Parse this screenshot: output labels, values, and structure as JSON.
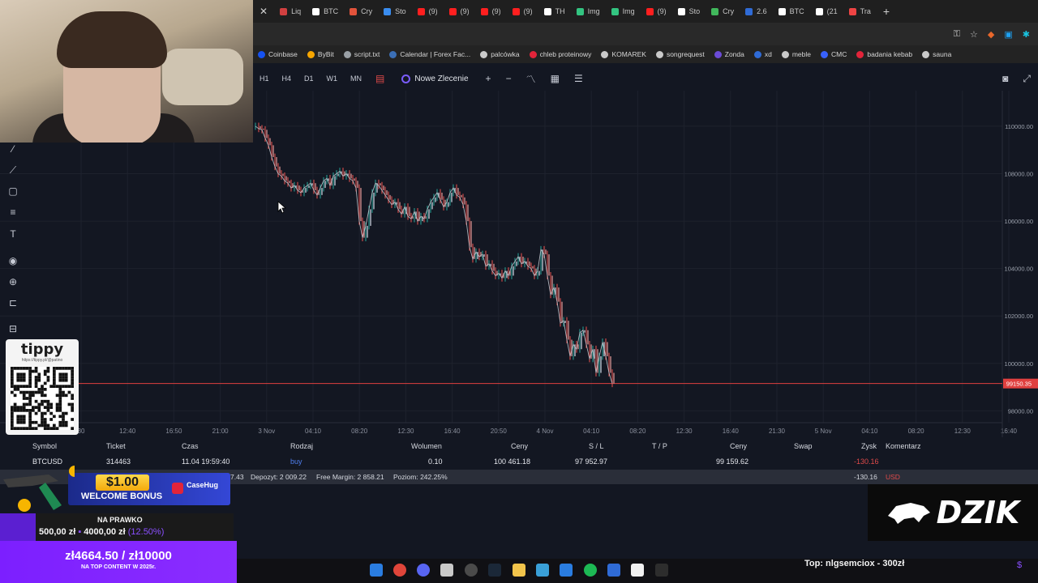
{
  "browser": {
    "tabs": [
      {
        "label": "Liq",
        "icon": "bookmark-icon",
        "color": "#d14040"
      },
      {
        "label": "BTC",
        "icon": "tradingview-icon",
        "color": "#ffffff"
      },
      {
        "label": "Cry",
        "icon": "triangle-icon",
        "color": "#e2533b"
      },
      {
        "label": "Sto",
        "icon": "chart-icon",
        "color": "#3a8df0"
      },
      {
        "label": "(9)",
        "icon": "youtube-icon",
        "color": "#ff1f1f"
      },
      {
        "label": "(9)",
        "icon": "youtube-icon",
        "color": "#ff1f1f"
      },
      {
        "label": "(9)",
        "icon": "youtube-icon",
        "color": "#ff1f1f"
      },
      {
        "label": "(9)",
        "icon": "youtube-icon",
        "color": "#ff1f1f"
      },
      {
        "label": "TH",
        "icon": "tradingview-icon",
        "color": "#ffffff"
      },
      {
        "label": "Img",
        "icon": "image-icon",
        "color": "#33c481"
      },
      {
        "label": "Img",
        "icon": "image-icon",
        "color": "#33c481"
      },
      {
        "label": "(9)",
        "icon": "youtube-icon",
        "color": "#ff1f1f"
      },
      {
        "label": "Sto",
        "icon": "tradingview-icon",
        "color": "#ffffff"
      },
      {
        "label": "Cry",
        "icon": "coin-icon",
        "color": "#41b85c"
      },
      {
        "label": "2.6",
        "icon": "triangle-icon",
        "color": "#2f6bd6"
      },
      {
        "label": "BTC",
        "icon": "bitcoin-icon",
        "color": "#ffffff"
      },
      {
        "label": "(21",
        "icon": "x-icon",
        "color": "#ffffff"
      },
      {
        "label": "Tra",
        "icon": "bar-icon",
        "color": "#e44"
      }
    ],
    "bookmarks": [
      {
        "label": "Coinbase",
        "color": "#1652f0"
      },
      {
        "label": "ByBit",
        "color": "#f7a600"
      },
      {
        "label": "script.txt",
        "color": "#9aa0a6"
      },
      {
        "label": "Calendar | Forex Fac...",
        "color": "#3b6fb6"
      },
      {
        "label": "palcówka",
        "color": "#c9c9c9"
      },
      {
        "label": "chleb proteinowy",
        "color": "#e2243a"
      },
      {
        "label": "KOMAREK",
        "color": "#c9c9c9"
      },
      {
        "label": "songrequest",
        "color": "#c9c9c9"
      },
      {
        "label": "Zonda",
        "color": "#6b4bd6"
      },
      {
        "label": "xd",
        "color": "#2f6bd6"
      },
      {
        "label": "meble",
        "color": "#c9c9c9"
      },
      {
        "label": "CMC",
        "color": "#3861fb"
      },
      {
        "label": "badania kebab",
        "color": "#e2243a"
      },
      {
        "label": "sauna",
        "color": "#c9c9c9"
      }
    ]
  },
  "toolbar": {
    "timeframes": [
      "H1",
      "H4",
      "D1",
      "W1",
      "MN"
    ],
    "new_order_label": "Nowe Zlecenie"
  },
  "chart_data": {
    "type": "line",
    "title": "",
    "xlabel": "",
    "ylabel": "",
    "y_ticks": [
      "110000.00",
      "108000.00",
      "106000.00",
      "104000.00",
      "102000.00",
      "100000.00",
      "98000.00"
    ],
    "ylim": [
      97500,
      111500
    ],
    "current_price_label": "99150.35",
    "current_price": 99150.35,
    "x_ticks": [
      "30",
      "12:40",
      "16:50",
      "21:00",
      "3 Nov",
      "04:10",
      "08:20",
      "12:30",
      "16:40",
      "20:50",
      "4 Nov",
      "04:10",
      "08:20",
      "12:30",
      "16:40",
      "21:30",
      "5 Nov",
      "04:10",
      "08:20",
      "12:30",
      "16:40"
    ],
    "series": [
      {
        "color": "#c9ccd4",
        "x_index": [
          0,
          2,
          4,
          6,
          8,
          10,
          12,
          14,
          16,
          18,
          20,
          22,
          24,
          26,
          28,
          30,
          32,
          34,
          36,
          38,
          40,
          42,
          44,
          46,
          48,
          50,
          52,
          54,
          56,
          58,
          60,
          62,
          64,
          66,
          68,
          70,
          72,
          74,
          76,
          78,
          80,
          82,
          84,
          86,
          88,
          90,
          92,
          94,
          96,
          98,
          100,
          102,
          104,
          106,
          108,
          110,
          112,
          114,
          116,
          118,
          120,
          122,
          124,
          126,
          128,
          130,
          132,
          134,
          136,
          138,
          140,
          142,
          144,
          146,
          148,
          150,
          152,
          154,
          156,
          158,
          160,
          162,
          164,
          166,
          168,
          170,
          172,
          174,
          176,
          178,
          180,
          182,
          184,
          186,
          188,
          190,
          192,
          194,
          196,
          198,
          200,
          202,
          204,
          206,
          208,
          210,
          212,
          214,
          216,
          218,
          220,
          222,
          224,
          226,
          228,
          230,
          232,
          234,
          236,
          238,
          240,
          242,
          244,
          246,
          248,
          250,
          252,
          254,
          256,
          258,
          260,
          262,
          264,
          266,
          268,
          270,
          272,
          274,
          276,
          278,
          280,
          282,
          284,
          286,
          288,
          290,
          292,
          294,
          296,
          298,
          300,
          302,
          304,
          306,
          308
        ],
        "values": [
          110000,
          109900,
          109850,
          109500,
          109200,
          108700,
          108300,
          108000,
          107900,
          107700,
          107600,
          107400,
          107500,
          107300,
          107200,
          107400,
          107500,
          107600,
          107300,
          107100,
          107400,
          107700,
          107800,
          107500,
          107900,
          108000,
          108100,
          107900,
          108000,
          107800,
          107700,
          107400,
          106000,
          105300,
          105800,
          106500,
          107200,
          107600,
          107500,
          107300,
          107100,
          106900,
          106700,
          106800,
          106500,
          106300,
          106600,
          106200,
          106100,
          106400,
          106000,
          106200,
          106100,
          106500,
          106800,
          107000,
          107200,
          106900,
          106600,
          106800,
          107200,
          107400,
          107100,
          107000,
          106700,
          106000,
          104900,
          104400,
          104700,
          104500,
          104600,
          104100,
          104200,
          103900,
          103700,
          103800,
          103600,
          103900,
          103700,
          104100,
          104300,
          104500,
          104200,
          104300,
          104100,
          104000,
          103700,
          103900,
          104800,
          104600,
          103700,
          102900,
          103200,
          102600,
          101700,
          101800,
          101000,
          100300,
          100800,
          100600,
          101300,
          101400,
          100800,
          100200,
          100600,
          99600,
          100300,
          100900,
          100300,
          99600,
          99150
        ]
      }
    ]
  },
  "positions_table": {
    "headers": [
      "Symbol",
      "Ticket",
      "Czas",
      "Rodzaj",
      "Wolumen",
      "Ceny",
      "S / L",
      "T / P",
      "Ceny",
      "Swap",
      "Zysk",
      "Komentarz"
    ],
    "row": {
      "symbol": "BTCUSD",
      "ticket": "314463",
      "time": "11.04 19:59:40",
      "type": "buy",
      "volume": "0.10",
      "open_price": "100 461.18",
      "sl": "97 952.97",
      "tp": "",
      "price": "99 159.62",
      "swap": "",
      "profit": "-130.16"
    },
    "summary": {
      "balance_fragment": "7.43",
      "deposit": "Depozyt: 2 009.22",
      "free_margin": "Free Margin: 2 858.21",
      "level": "Poziom: 242.25%",
      "profit": "-130.16",
      "currency": "USD"
    }
  },
  "overlays": {
    "tippy": {
      "logo": "tippy",
      "url": "https://tippy.pl/@patino"
    },
    "bonus": {
      "amount": "$1.00",
      "label": "WELCOME BONUS",
      "brand": "CaseHug"
    },
    "goal": {
      "title": "NA PRAWKO",
      "current": "500,00 zł",
      "target": "4000,00 zł",
      "percent": "(12.50%)"
    },
    "top_content": {
      "amount": "zł4664.50 / zł10000",
      "label": "NA TOP CONTENT W 2025r."
    },
    "dzik": {
      "label": "DZIK"
    },
    "top_donor": "Top: nlgsemciox - 300zł"
  }
}
